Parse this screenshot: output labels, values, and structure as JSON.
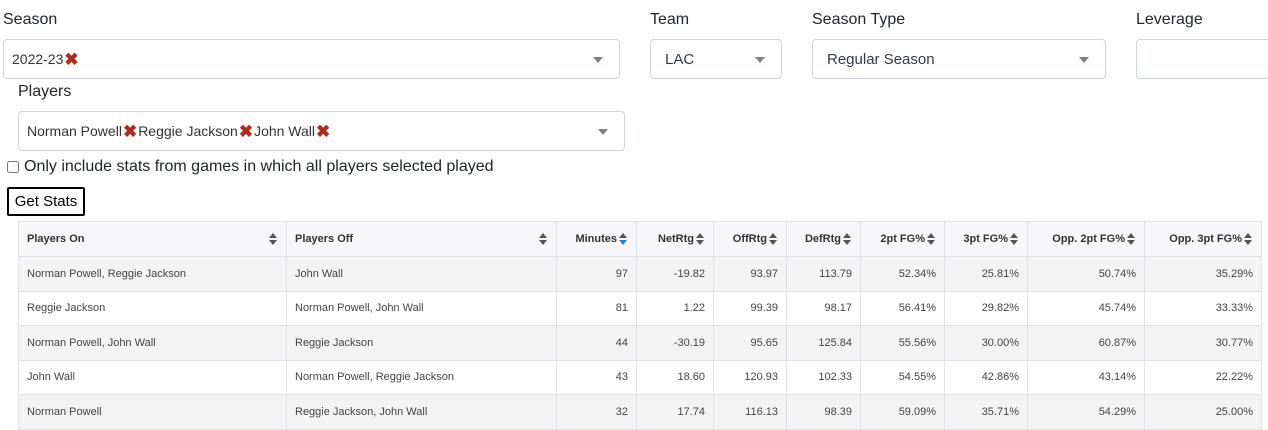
{
  "filters": {
    "season": {
      "label": "Season",
      "selected": [
        "2022-23"
      ]
    },
    "team": {
      "label": "Team",
      "value": "LAC"
    },
    "season_type": {
      "label": "Season Type",
      "value": "Regular Season"
    },
    "leverage": {
      "label": "Leverage",
      "value": ""
    },
    "players": {
      "label": "Players",
      "selected": [
        "Norman Powell",
        "Reggie Jackson",
        "John Wall"
      ]
    }
  },
  "remove_glyph": "✖",
  "only_games_checkbox": {
    "label": "Only include stats from games in which all players selected played",
    "checked": false
  },
  "get_stats_button": "Get Stats",
  "table": {
    "columns": [
      "Players On",
      "Players Off",
      "Minutes",
      "NetRtg",
      "OffRtg",
      "DefRtg",
      "2pt FG%",
      "3pt FG%",
      "Opp. 2pt FG%",
      "Opp. 3pt FG%"
    ],
    "sorted_column": "Minutes",
    "sort_direction": "descending",
    "sort_active_color": "#2f80c7",
    "rows": [
      [
        "Norman Powell, Reggie Jackson",
        "John Wall",
        "97",
        "-19.82",
        "93.97",
        "113.79",
        "52.34%",
        "25.81%",
        "50.74%",
        "35.29%"
      ],
      [
        "Reggie Jackson",
        "Norman Powell, John Wall",
        "81",
        "1.22",
        "99.39",
        "98.17",
        "56.41%",
        "29.82%",
        "45.74%",
        "33.33%"
      ],
      [
        "Norman Powell, John Wall",
        "Reggie Jackson",
        "44",
        "-30.19",
        "95.65",
        "125.84",
        "55.56%",
        "30.00%",
        "60.87%",
        "30.77%"
      ],
      [
        "John Wall",
        "Norman Powell, Reggie Jackson",
        "43",
        "18.60",
        "120.93",
        "102.33",
        "54.55%",
        "42.86%",
        "43.14%",
        "22.22%"
      ],
      [
        "Norman Powell",
        "Reggie Jackson, John Wall",
        "32",
        "17.74",
        "116.13",
        "98.39",
        "59.09%",
        "35.71%",
        "54.29%",
        "25.00%"
      ]
    ]
  }
}
